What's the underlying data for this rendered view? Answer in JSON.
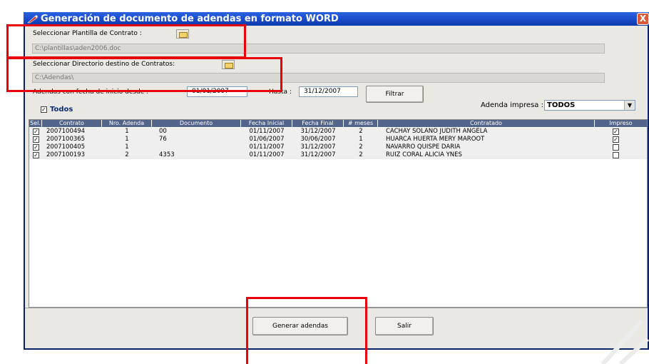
{
  "window": {
    "title": "Generación de documento de adendas en formato WORD",
    "close_label": "X"
  },
  "template": {
    "label": "Seleccionar Plantilla de Contrato :",
    "path": "C:\\plantillas\\aden2006.doc"
  },
  "destination": {
    "label": "Seleccionar Directorio destino de Contratos:",
    "path": "C:\\Adendas\\"
  },
  "filter": {
    "from_label": "Adendas con fecha de inicio desde :",
    "from_value": "01/01/2007",
    "to_label": "Hasta :",
    "to_value": "31/12/2007",
    "button_label": "Filtrar"
  },
  "todos": {
    "label": "Todos",
    "checked": true
  },
  "adenda_impresa": {
    "label": "Adenda impresa :",
    "value": "TODOS"
  },
  "table": {
    "columns": [
      "Sel.",
      "Contrato",
      "Nro. Adenda",
      "Documento",
      "Fecha Inicial",
      "Fecha Final",
      "# meses",
      "Contratado",
      "Impreso"
    ],
    "rows": [
      {
        "sel": true,
        "contrato": "2007100494",
        "nro": "1",
        "doc": "00",
        "ini": "01/11/2007",
        "fin": "31/12/2007",
        "meses": "2",
        "contratado": "CACHAY SOLANO JUDITH ANGELA",
        "impreso": true
      },
      {
        "sel": true,
        "contrato": "2007100365",
        "nro": "1",
        "doc": "76",
        "ini": "01/06/2007",
        "fin": "30/06/2007",
        "meses": "1",
        "contratado": "HUARCA HUERTA MERY MAROOT",
        "impreso": true
      },
      {
        "sel": true,
        "contrato": "2007100405",
        "nro": "1",
        "doc": "",
        "ini": "01/11/2007",
        "fin": "31/12/2007",
        "meses": "2",
        "contratado": "NAVARRO QUISPE DARIA",
        "impreso": false
      },
      {
        "sel": true,
        "contrato": "2007100193",
        "nro": "2",
        "doc": "4353",
        "ini": "01/11/2007",
        "fin": "31/12/2007",
        "meses": "2",
        "contratado": "RUIZ CORAL ALICIA YNES",
        "impreso": false
      }
    ]
  },
  "buttons": {
    "generate": "Generar adendas",
    "exit": "Salir"
  },
  "colors": {
    "title_bar": "#1d4fcf",
    "grid_header": "#53648a",
    "highlight": "#e8000b"
  }
}
